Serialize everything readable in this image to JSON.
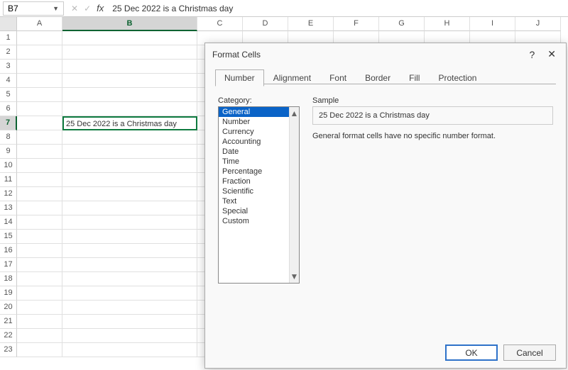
{
  "formula_bar": {
    "cell_ref": "B7",
    "formula": "25 Dec 2022 is a Christmas  day"
  },
  "columns": [
    "A",
    "B",
    "C",
    "D",
    "E",
    "F",
    "G",
    "H",
    "I",
    "J"
  ],
  "selected_col": "B",
  "rows": [
    "1",
    "2",
    "3",
    "4",
    "5",
    "6",
    "7",
    "8",
    "9",
    "10",
    "11",
    "12",
    "13",
    "14",
    "15",
    "16",
    "17",
    "18",
    "19",
    "20",
    "21",
    "22",
    "23"
  ],
  "selected_row": "7",
  "cell_b7": "25 Dec 2022 is a Christmas  day",
  "dialog": {
    "title": "Format Cells",
    "tabs": [
      "Number",
      "Alignment",
      "Font",
      "Border",
      "Fill",
      "Protection"
    ],
    "active_tab": "Number",
    "category_label": "Category:",
    "categories": [
      "General",
      "Number",
      "Currency",
      "Accounting",
      "Date",
      "Time",
      "Percentage",
      "Fraction",
      "Scientific",
      "Text",
      "Special",
      "Custom"
    ],
    "selected_category": "General",
    "sample_label": "Sample",
    "sample_value": "25 Dec 2022 is a Christmas  day",
    "description": "General format cells have no specific number format.",
    "ok": "OK",
    "cancel": "Cancel"
  }
}
